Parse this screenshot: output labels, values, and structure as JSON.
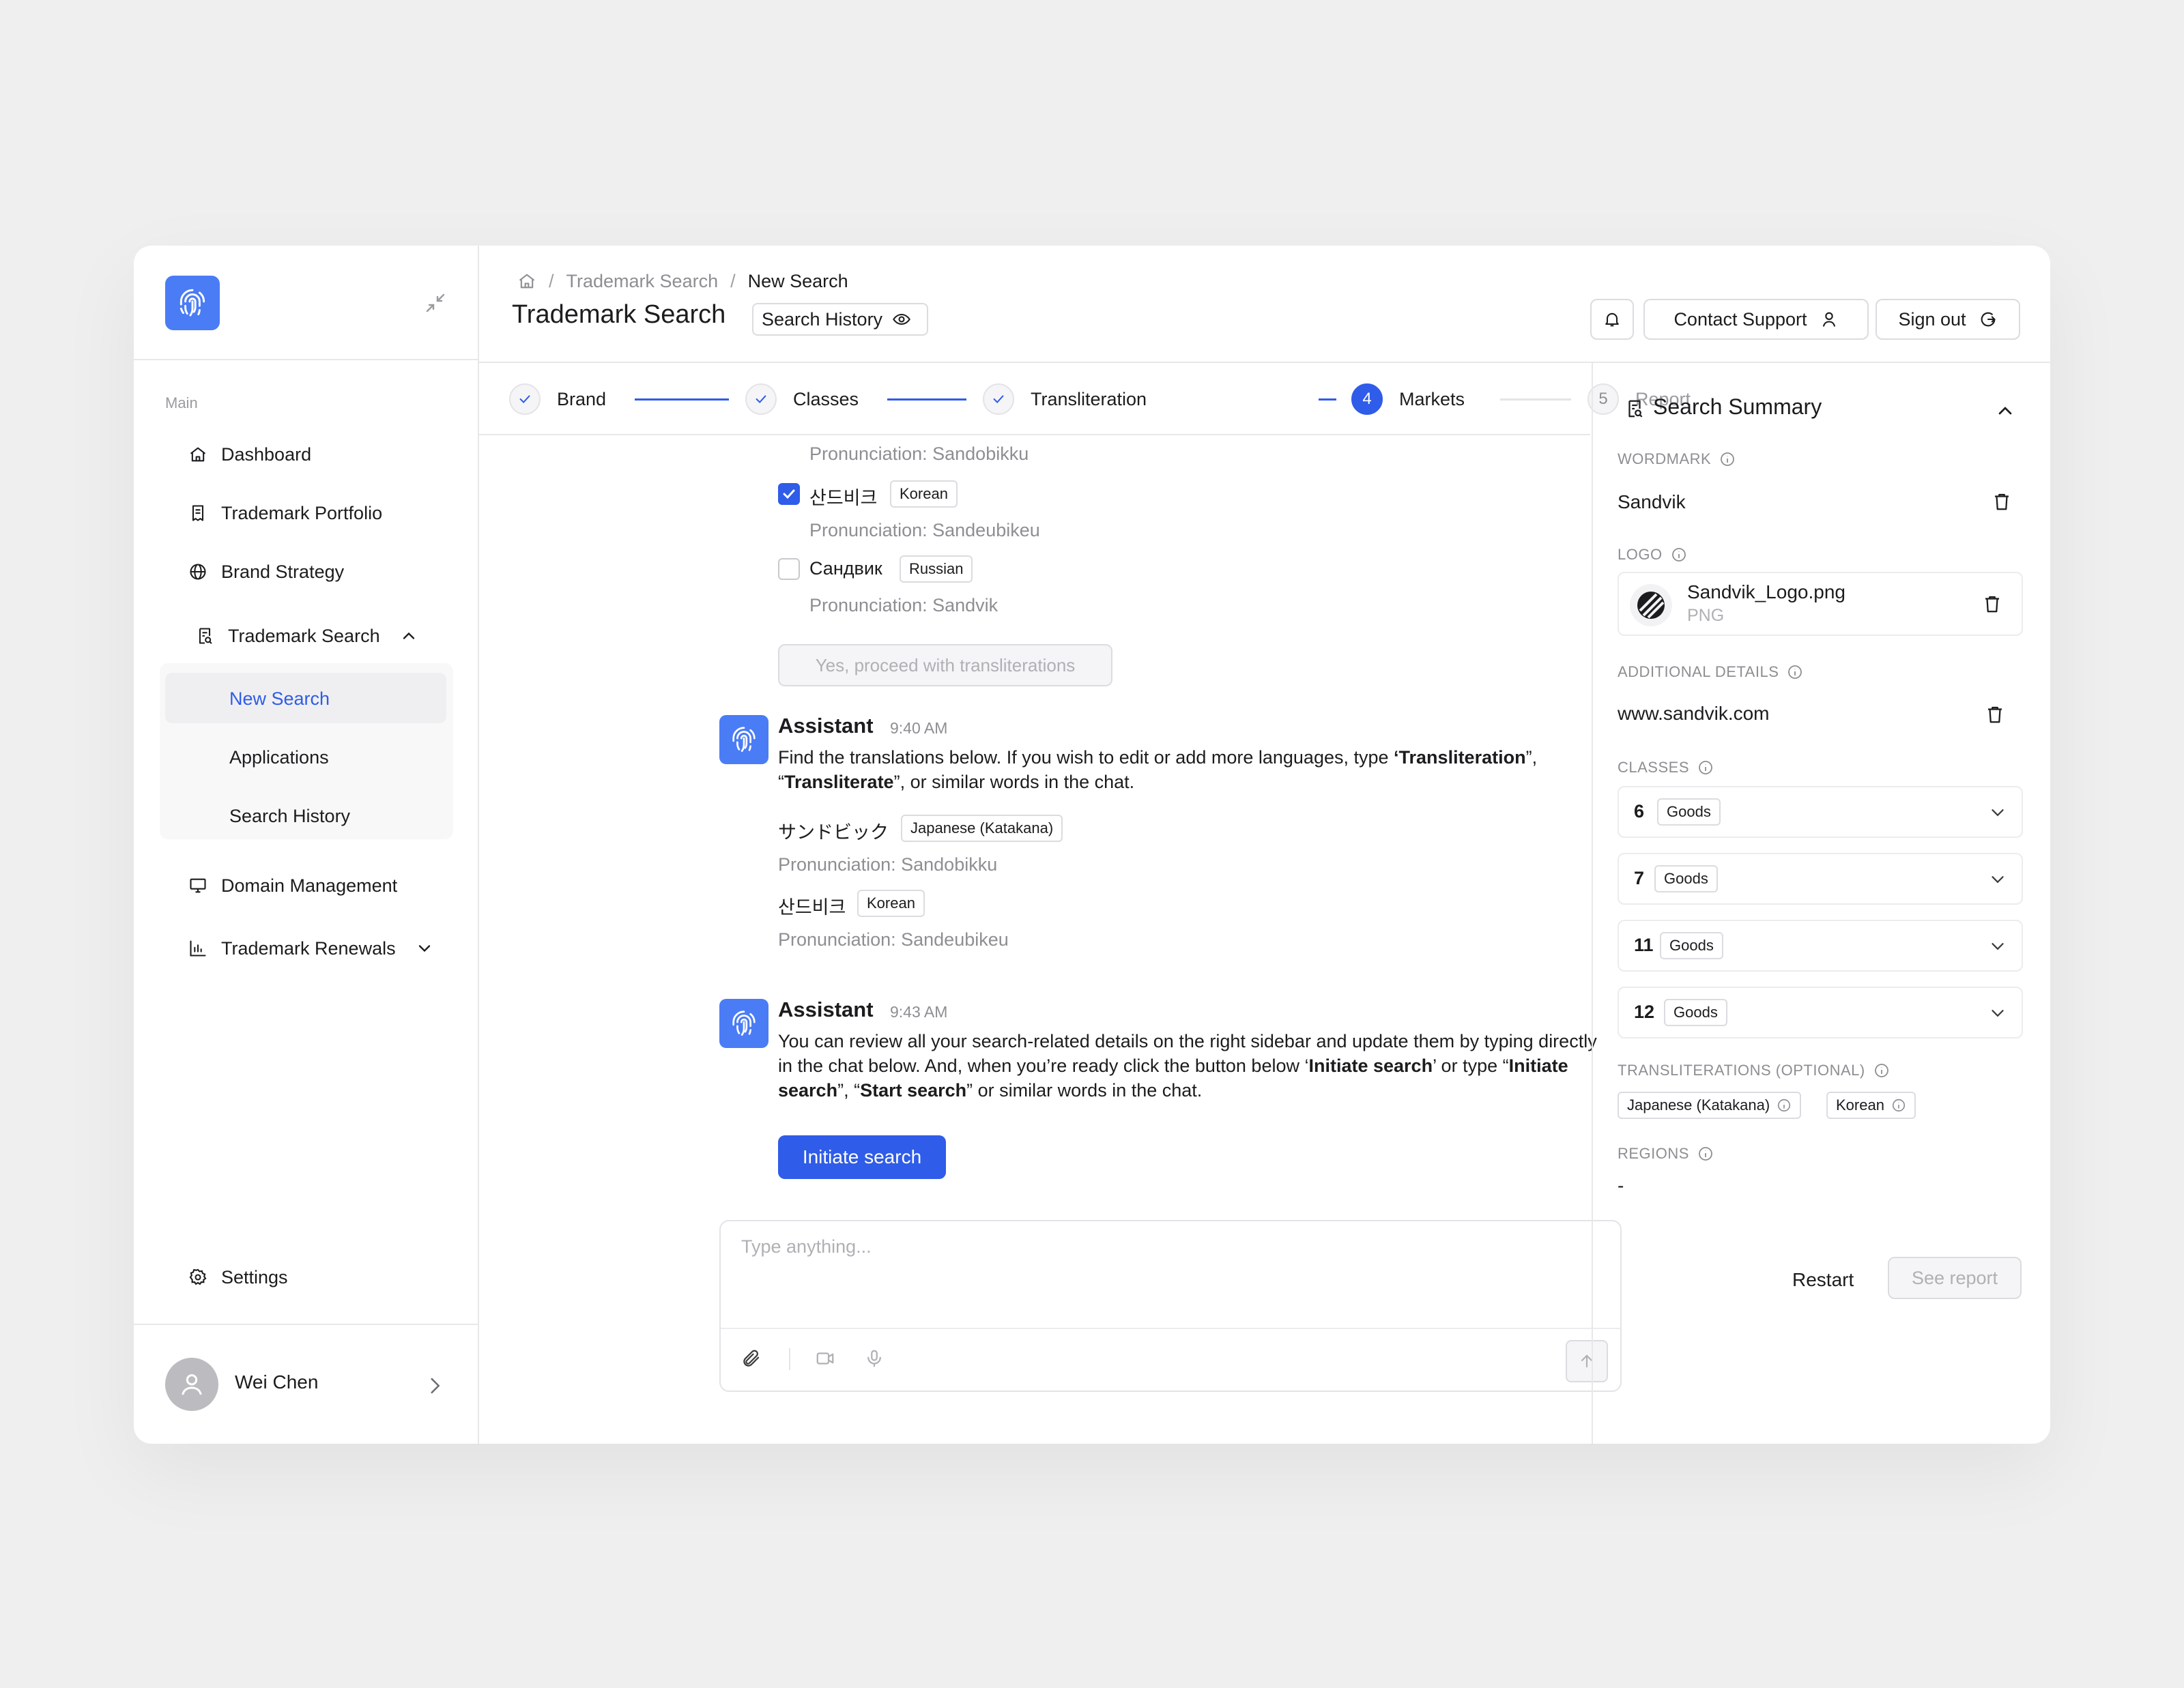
{
  "sidebar": {
    "section_label": "Main",
    "items": {
      "dashboard": "Dashboard",
      "portfolio": "Trademark Portfolio",
      "brand_strategy": "Brand Strategy",
      "trademark_search": "Trademark Search",
      "domain_management": "Domain Management",
      "renewals": "Trademark Renewals",
      "settings": "Settings"
    },
    "sub_items": {
      "new_search": "New Search",
      "applications": "Applications",
      "search_history": "Search History"
    },
    "user": {
      "name": "Wei Chen"
    }
  },
  "header": {
    "breadcrumb": {
      "parent": "Trademark Search",
      "current": "New Search"
    },
    "title": "Trademark Search",
    "history_chip": "Search History",
    "contact_support": "Contact Support",
    "sign_out": "Sign out"
  },
  "stepper": {
    "steps": [
      {
        "label": "Brand",
        "state": "done"
      },
      {
        "label": "Classes",
        "state": "done"
      },
      {
        "label": "Transliteration",
        "state": "done"
      },
      {
        "label": "Markets",
        "number": "4",
        "state": "active"
      },
      {
        "label": "Report",
        "number": "5",
        "state": "pending"
      }
    ]
  },
  "chat": {
    "top_block": {
      "pron_top": "Pronunciation: Sandobikku",
      "options": [
        {
          "word": "산드비크",
          "lang": "Korean",
          "pron": "Pronunciation: Sandeubikeu",
          "checked": true
        },
        {
          "word": "Сандвик",
          "lang": "Russian",
          "pron": "Pronunciation: Sandvik",
          "checked": false
        }
      ],
      "proceed_button": "Yes, proceed with transliterations"
    },
    "message1": {
      "sender": "Assistant",
      "time": "9:40 AM",
      "t1": "Find the translations below. If you wish to edit or add more languages, type ",
      "b1": "‘Transliteration",
      "t2": "”, “",
      "b2": "Transliterate",
      "t3": "”, or similar words in the chat.",
      "items": [
        {
          "word": "サンドビック",
          "lang": "Japanese (Katakana)",
          "pron": "Pronunciation: Sandobikku"
        },
        {
          "word": "산드비크",
          "lang": "Korean",
          "pron": "Pronunciation: Sandeubikeu"
        }
      ]
    },
    "message2": {
      "sender": "Assistant",
      "time": "9:43 AM",
      "t1": "You can review all your search-related details on the right sidebar and update them by typing directly in the chat below. And, when you’re ready click the button below ‘",
      "b1": "Initiate search",
      "t2": "’ or type “",
      "b2": "Initiate search",
      "t3": "”, “",
      "b3": "Start search",
      "t4": "” or similar words in the chat.",
      "button": "Initiate search"
    },
    "composer": {
      "placeholder": "Type anything..."
    }
  },
  "summary": {
    "title": "Search Summary",
    "wordmark_label": "WORDMARK",
    "wordmark": "Sandvik",
    "logo_label": "LOGO",
    "logo_file": "Sandvik_Logo.png",
    "logo_type": "PNG",
    "details_label": "ADDITIONAL DETAILS",
    "details": "www.sandvik.com",
    "classes_label": "CLASSES",
    "classes": [
      {
        "num": "6",
        "type": "Goods"
      },
      {
        "num": "7",
        "type": "Goods"
      },
      {
        "num": "11",
        "type": "Goods"
      },
      {
        "num": "12",
        "type": "Goods"
      }
    ],
    "translit_label": "TRANSLITERATIONS (OPTIONAL)",
    "translits": [
      "Japanese (Katakana)",
      "Korean"
    ],
    "regions_label": "REGIONS",
    "regions": "-",
    "restart": "Restart",
    "see_report": "See report"
  },
  "colors": {
    "accent": "#2f5ce8",
    "logo_tile": "#4a7cf5"
  }
}
